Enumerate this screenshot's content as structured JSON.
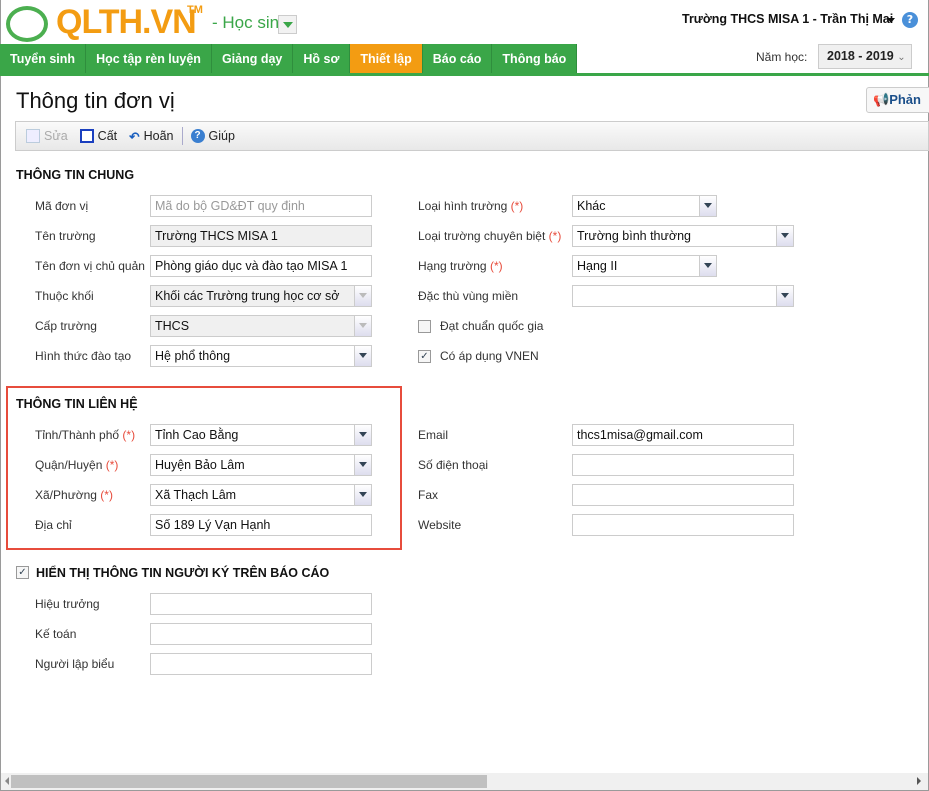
{
  "header": {
    "logo": "QLTH.VN",
    "trademark": "TM",
    "role": "- Học sinh",
    "user": "Trường THCS MISA 1  - Trần Thị Mai",
    "year_label": "Năm học:",
    "year_value": "2018 - 2019"
  },
  "nav": [
    "Tuyển sinh",
    "Học tập rèn luyện",
    "Giảng dạy",
    "Hồ sơ",
    "Thiết lập",
    "Báo cáo",
    "Thông báo"
  ],
  "nav_active": "Thiết lập",
  "colors": {
    "brand_green": "#3aa648",
    "brand_orange": "#f39c12",
    "highlight_red": "#e74c3c"
  },
  "page": {
    "title": "Thông tin đơn vị",
    "feedback": "Phản"
  },
  "toolbar": {
    "edit": "Sửa",
    "save": "Cất",
    "undo": "Hoãn",
    "help": "Giúp"
  },
  "general": {
    "title": "THÔNG TIN CHUNG",
    "left": [
      {
        "label": "Mã đơn vị",
        "value": "",
        "placeholder": "Mã do bộ GD&ĐT quy định"
      },
      {
        "label": "Tên trường",
        "value": "Trường THCS MISA 1"
      },
      {
        "label": "Tên đơn vị chủ quản",
        "value": "Phòng giáo dục và đào tạo MISA 1"
      },
      {
        "label": "Thuộc khối",
        "value": "Khối các Trường trung học cơ sở"
      },
      {
        "label": "Cấp trường",
        "value": "THCS"
      },
      {
        "label": "Hình thức đào tạo",
        "value": "Hệ phổ thông"
      }
    ],
    "right": [
      {
        "label": "Loại hình trường",
        "req": "(*)",
        "value": "Khác"
      },
      {
        "label": "Loại trường chuyên biệt",
        "req": "(*)",
        "value": "Trường bình thường"
      },
      {
        "label": "Hạng trường",
        "req": "(*)",
        "value": "Hạng II"
      },
      {
        "label": "Đặc thù vùng miền",
        "req": "",
        "value": ""
      }
    ],
    "checks": [
      {
        "label": "Đạt chuẩn quốc gia",
        "checked": false
      },
      {
        "label": "Có áp dụng VNEN",
        "checked": true
      }
    ]
  },
  "contact": {
    "title": "THÔNG TIN LIÊN HỆ",
    "left": [
      {
        "label": "Tỉnh/Thành phố",
        "req": "(*)",
        "value": "Tỉnh Cao Bằng"
      },
      {
        "label": "Quận/Huyện",
        "req": "(*)",
        "value": "Huyện Bảo Lâm"
      },
      {
        "label": "Xã/Phường",
        "req": "(*)",
        "value": "Xã Thạch Lâm"
      },
      {
        "label": "Địa chỉ",
        "req": "",
        "value": "Số 189 Lý Vạn Hạnh"
      }
    ],
    "right": [
      {
        "label": "Email",
        "value": "thcs1misa@gmail.com"
      },
      {
        "label": "Số điện thoại",
        "value": ""
      },
      {
        "label": "Fax",
        "value": ""
      },
      {
        "label": "Website",
        "value": ""
      }
    ]
  },
  "signers": {
    "title": "HIỂN THỊ THÔNG TIN NGƯỜI KÝ TRÊN BÁO CÁO",
    "checked": true,
    "rows": [
      {
        "label": "Hiệu trưởng",
        "value": ""
      },
      {
        "label": "Kế toán",
        "value": ""
      },
      {
        "label": "Người lập biểu",
        "value": ""
      }
    ]
  }
}
